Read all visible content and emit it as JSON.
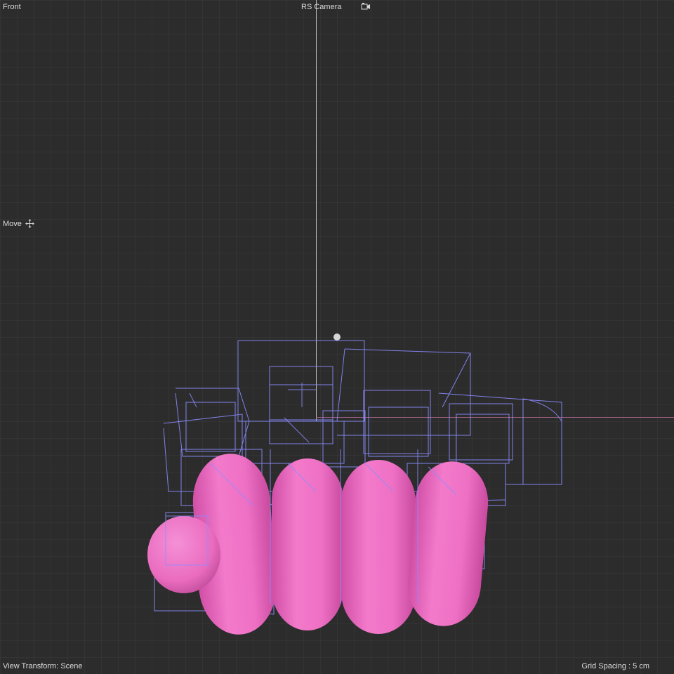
{
  "viewport": {
    "view_name": "Front",
    "camera_label": "RS Camera",
    "camera_icon": "camera-icon",
    "tool_label": "Move",
    "tool_icon": "move-icon",
    "view_transform": "View Transform: Scene",
    "grid_spacing": "Grid Spacing : 5 cm"
  },
  "colors": {
    "background": "#2c2c2c",
    "wireframe": "#8a8cff",
    "object": "#f06ec4",
    "y_axis": "#bfbfbf",
    "x_axis": "#9c5f83"
  }
}
